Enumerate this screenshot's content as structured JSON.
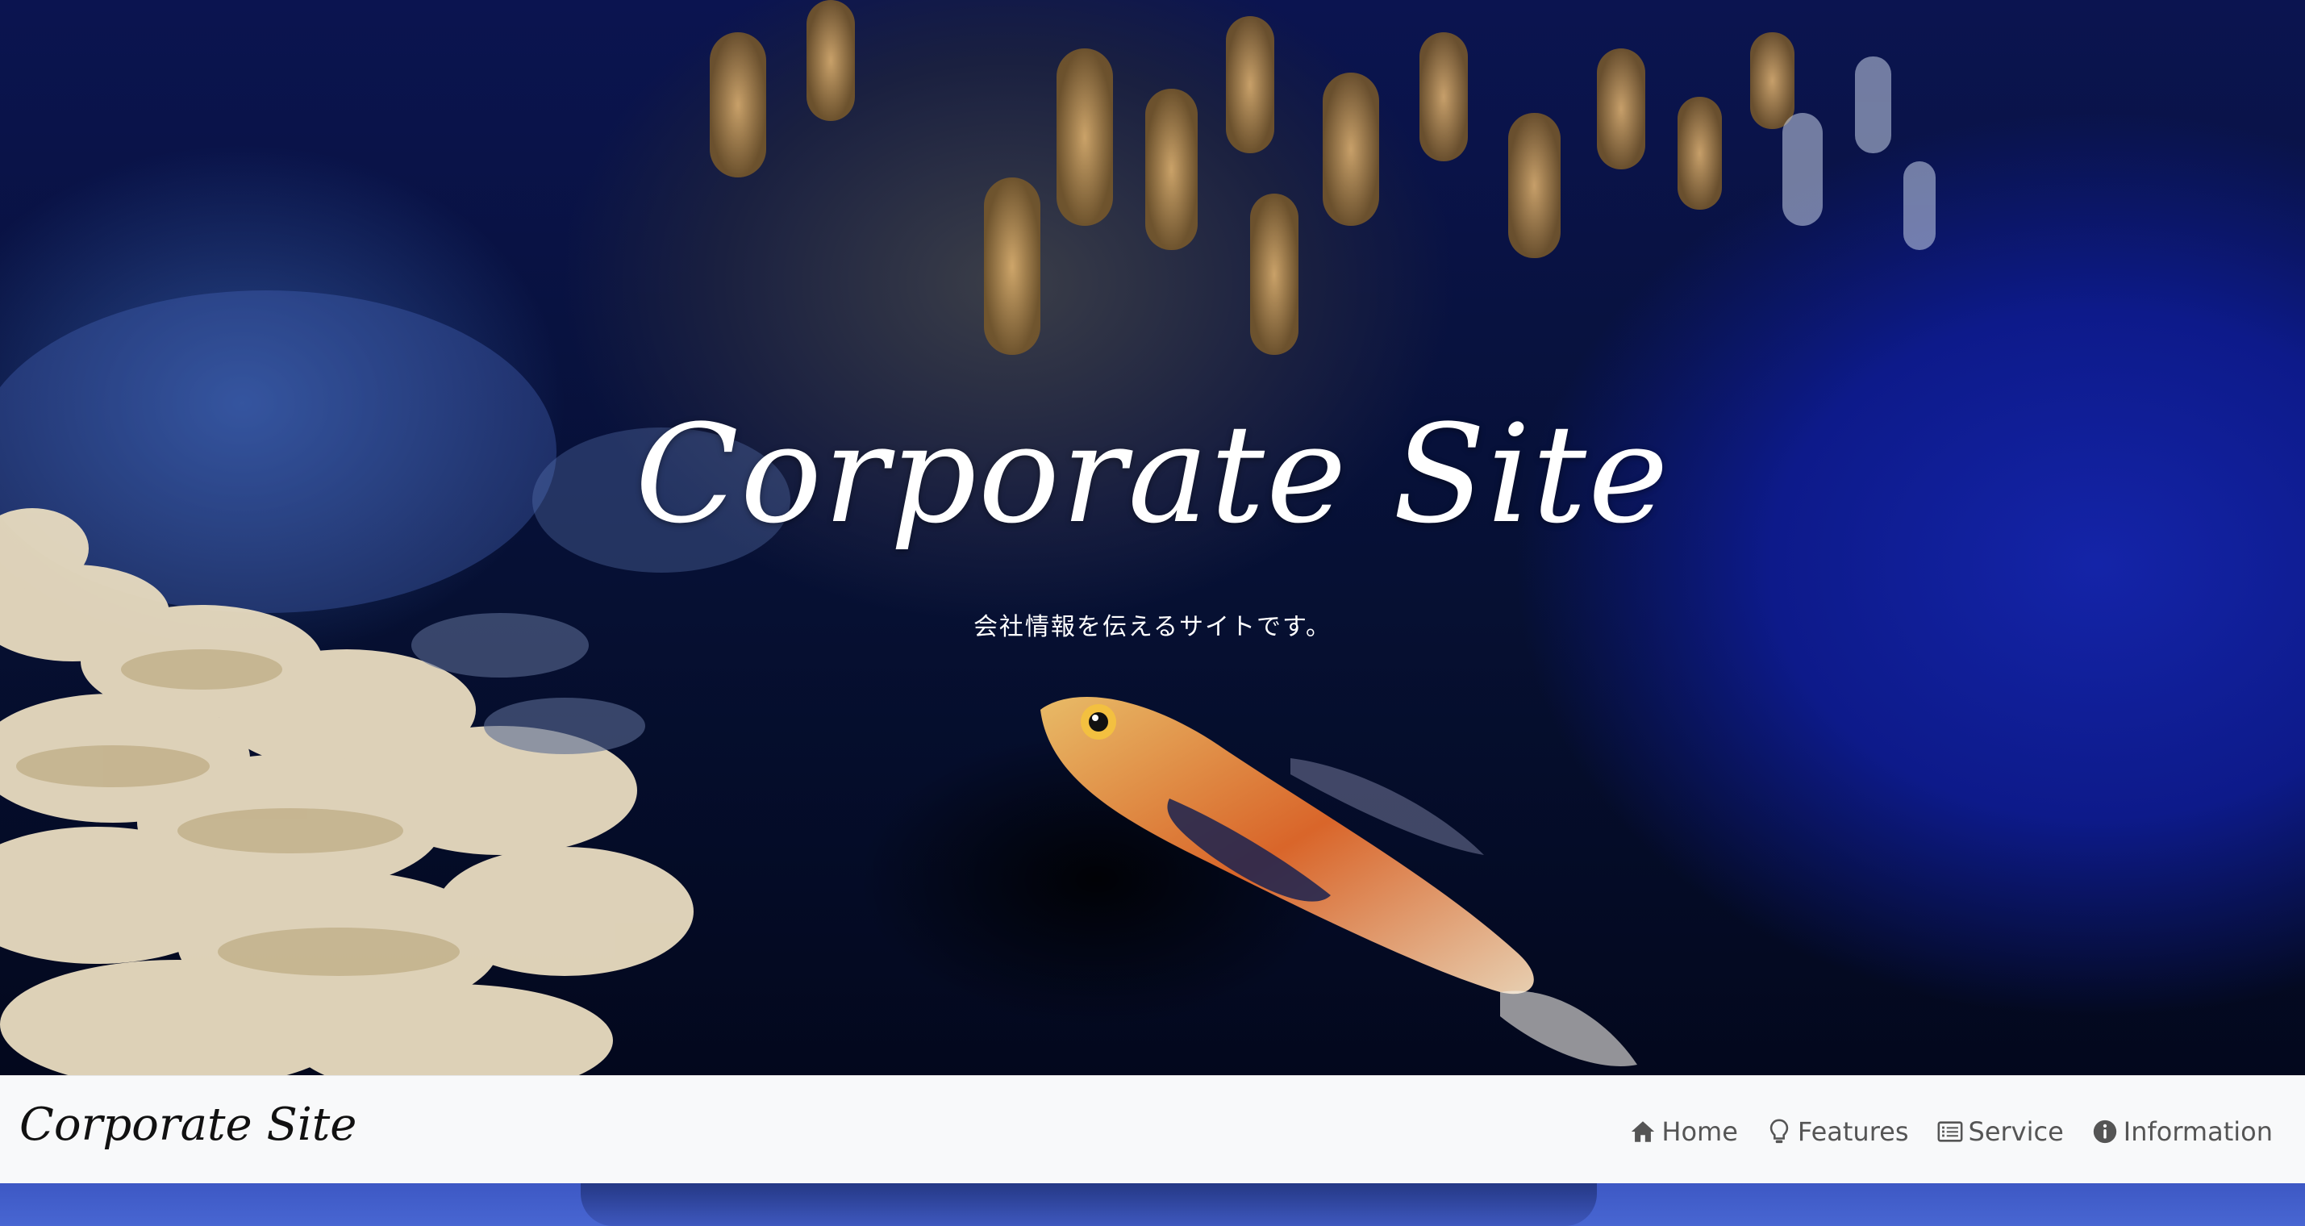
{
  "hero": {
    "title": "Corporate Site",
    "subtitle": "会社情報を伝えるサイトです。"
  },
  "navbar": {
    "brand": "Corporate Site",
    "links": [
      {
        "label": "Home",
        "icon": "home-icon"
      },
      {
        "label": "Features",
        "icon": "lightbulb-icon"
      },
      {
        "label": "Service",
        "icon": "list-icon"
      },
      {
        "label": "Information",
        "icon": "info-icon"
      }
    ]
  },
  "colors": {
    "navbar_bg": "#f8f9fa",
    "nav_text": "#555555",
    "hero_text": "#ffffff"
  }
}
